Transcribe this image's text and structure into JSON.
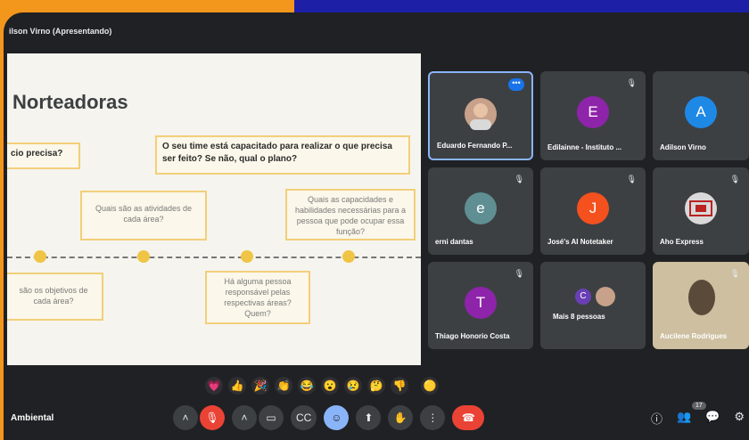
{
  "presenter_label": "ilson Virno (Apresentando)",
  "slide": {
    "title": "Norteadoras",
    "q_partial": "cio precisa?",
    "q_main": "O seu time está capacitado para realizar o que precisa ser feito? Se não, qual o plano?",
    "q_atividades": "Quais são as atividades de cada área?",
    "q_capacidades": "Quais as capacidades e habilidades necessárias para a pessoa que pode ocupar essa função?",
    "q_objetivos": "são os objetivos de cada área?",
    "q_pessoa": "Há alguma pessoa responsável pelas respectivas áreas? Quem?"
  },
  "participants": [
    {
      "name": "Eduardo Fernando P...",
      "avatar": "",
      "color": "#c8a18a"
    },
    {
      "name": "Edilainne - Instituto ...",
      "avatar": "E",
      "color": "#8e24aa"
    },
    {
      "name": "Adilson Virno",
      "avatar": "A",
      "color": "#1e88e5"
    },
    {
      "name": "erni dantas",
      "avatar": "e",
      "color": "#5f8f92"
    },
    {
      "name": "José's AI Notetaker",
      "avatar": "J",
      "color": "#f4511e"
    },
    {
      "name": "Aho Express",
      "avatar": "",
      "color": "#d9d9d9"
    },
    {
      "name": "Thiago Honorio Costa",
      "avatar": "T",
      "color": "#8e24aa"
    },
    {
      "name": "Mais 8 pessoas",
      "avatar": "C",
      "color": "#6a3fb5"
    },
    {
      "name": "Aucilene Rodrigues",
      "avatar": "",
      "color": "#d7c8a8"
    }
  ],
  "bottom": {
    "meeting_label": "Ambiental",
    "people_count": "17"
  },
  "icons": {
    "mic_off": "mic-off-icon",
    "more": "more-dots-icon"
  }
}
